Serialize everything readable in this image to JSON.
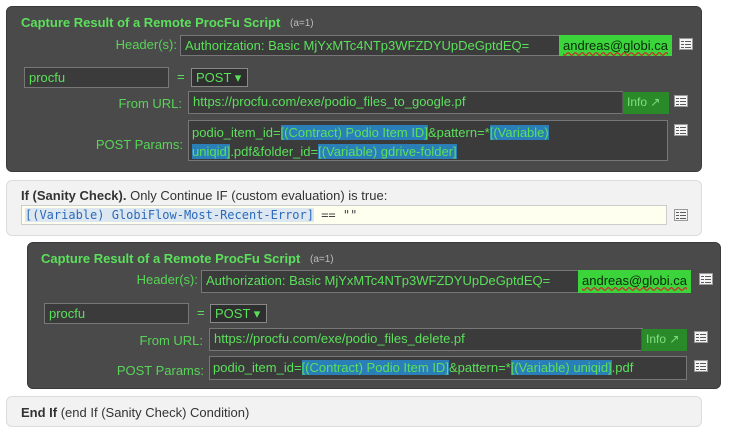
{
  "block1": {
    "title": "Capture Result of a Remote ProcFu Script",
    "note": "(a=1)",
    "headers_label": "Header(s):",
    "headers_value": "Authorization: Basic MjYxMTc4NTp3WFZDYUpDeGptdEQ=",
    "email": "andreas@globi.ca",
    "profile_value": "procfu",
    "equals": "=",
    "method": "POST ▾",
    "from_url_label": "From URL:",
    "from_url_value": "https://procfu.com/exe/podio_files_to_google.pf",
    "info_button": "Info ↗",
    "post_params_label": "POST Params:",
    "params": {
      "p1": "podio_item_id=",
      "t1": "[(Contract) Podio Item ID]",
      "p2": "&pattern=*",
      "t2a": "[(Variable)",
      "t2b": "uniqid]",
      "p3": ".pdf&folder_id=",
      "t3": "[(Variable) gdrive-folder]"
    }
  },
  "sanity": {
    "strong": "If (Sanity Check).",
    "rest": " Only Continue IF (custom evaluation) is true:",
    "expr_token": "[(Variable) GlobiFlow-Most-Recent-Error]",
    "expr_rest": " == \"\""
  },
  "block2": {
    "title": "Capture Result of a Remote ProcFu Script",
    "note": "(a=1)",
    "headers_label": "Header(s):",
    "headers_value": "Authorization: Basic MjYxMTc4NTp3WFZDYUpDeGptdEQ=",
    "email": "andreas@globi.ca",
    "profile_value": "procfu",
    "equals": "=",
    "method": "POST ▾",
    "from_url_label": "From URL:",
    "from_url_value": "https://procfu.com/exe/podio_files_delete.pf",
    "info_button": "Info ↗",
    "post_params_label": "POST Params:",
    "params": {
      "p1": "podio_item_id=",
      "t1": "[(Contract) Podio Item ID]",
      "p2": "&pattern=*",
      "t2": "[(Variable) uniqid]",
      "p3": ".pdf"
    }
  },
  "endif": {
    "strong": "End If",
    "rest": " (end If (Sanity Check) Condition)"
  }
}
